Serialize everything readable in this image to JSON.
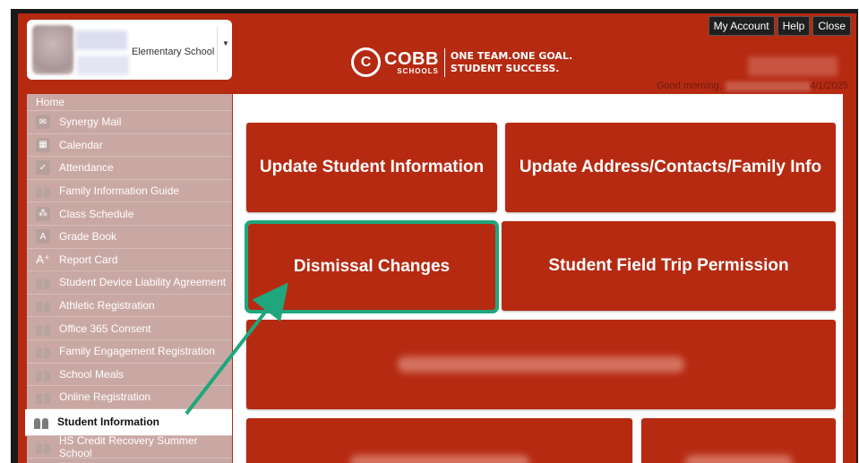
{
  "header": {
    "school_name": "Elementary School",
    "logo": {
      "brand": "COBB",
      "sub": "SCHOOLS",
      "tagline_1": "ONE TEAM.ONE GOAL.",
      "tagline_2": "STUDENT SUCCESS."
    },
    "buttons": {
      "my_account": "My Account",
      "help": "Help",
      "close": "Close"
    },
    "greeting": "Good morning,",
    "date": "4/1/2025"
  },
  "sidebar": {
    "home": "Home",
    "items": [
      {
        "label": "Synergy Mail",
        "icon": "mail-icon"
      },
      {
        "label": "Calendar",
        "icon": "calendar-icon"
      },
      {
        "label": "Attendance",
        "icon": "attendance-icon"
      },
      {
        "label": "Family Information Guide",
        "icon": "people-icon"
      },
      {
        "label": "Class Schedule",
        "icon": "schedule-icon"
      },
      {
        "label": "Grade Book",
        "icon": "gradebook-icon"
      },
      {
        "label": "Report Card",
        "icon": "report-card-icon"
      },
      {
        "label": "Student Device Liability Agreement",
        "icon": "people-icon"
      },
      {
        "label": "Athletic Registration",
        "icon": "people-icon"
      },
      {
        "label": "Office 365 Consent",
        "icon": "people-icon"
      },
      {
        "label": "Family Engagement Registration",
        "icon": "people-icon"
      },
      {
        "label": "School Meals",
        "icon": "people-icon"
      },
      {
        "label": "Online Registration",
        "icon": "people-icon"
      },
      {
        "label": "Student Information",
        "icon": "people-icon"
      },
      {
        "label": "HS Credit Recovery Summer School",
        "icon": "people-icon"
      }
    ]
  },
  "tiles": {
    "update_student_info": "Update Student Information",
    "update_address": "Update Address/Contacts/Family Info",
    "dismissal": "Dismissal Changes",
    "field_trip": "Student Field Trip Permission"
  },
  "colors": {
    "brand_red": "#b62a12",
    "highlight_green": "#1fa67d"
  }
}
